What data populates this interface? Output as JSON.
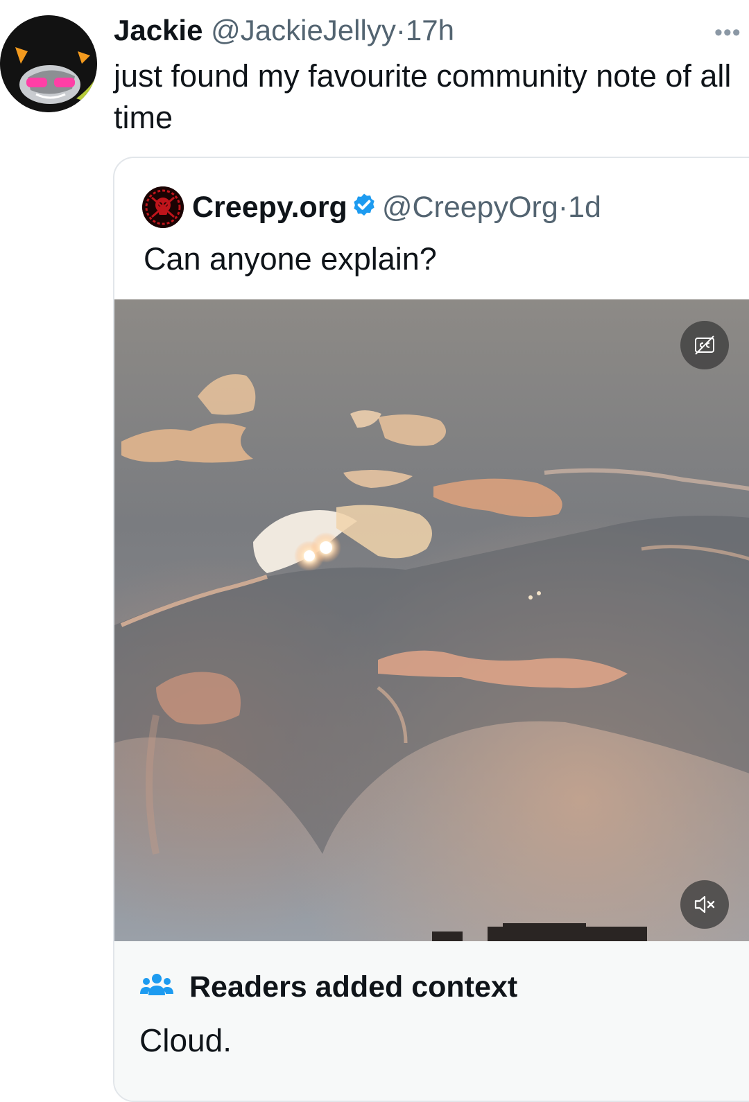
{
  "tweet": {
    "display_name": "Jackie",
    "handle": "@JackieJellyy",
    "separator": "·",
    "time": "17h",
    "more_label": "•••",
    "text": "just found my favourite community note of all time"
  },
  "quote": {
    "display_name": "Creepy.org",
    "handle": "@CreepyOrg",
    "separator": "·",
    "time": "1d",
    "text": "Can anyone explain?"
  },
  "media": {
    "captions_icon": "captions-off-icon",
    "mute_icon": "volume-muted-icon"
  },
  "community_note": {
    "icon": "people-icon",
    "title": "Readers added context",
    "body": "Cloud."
  },
  "colors": {
    "verified_blue": "#1d9bf0",
    "secondary_text": "#536471",
    "note_background": "#f7f9f9",
    "card_border": "#e2e6ea"
  }
}
